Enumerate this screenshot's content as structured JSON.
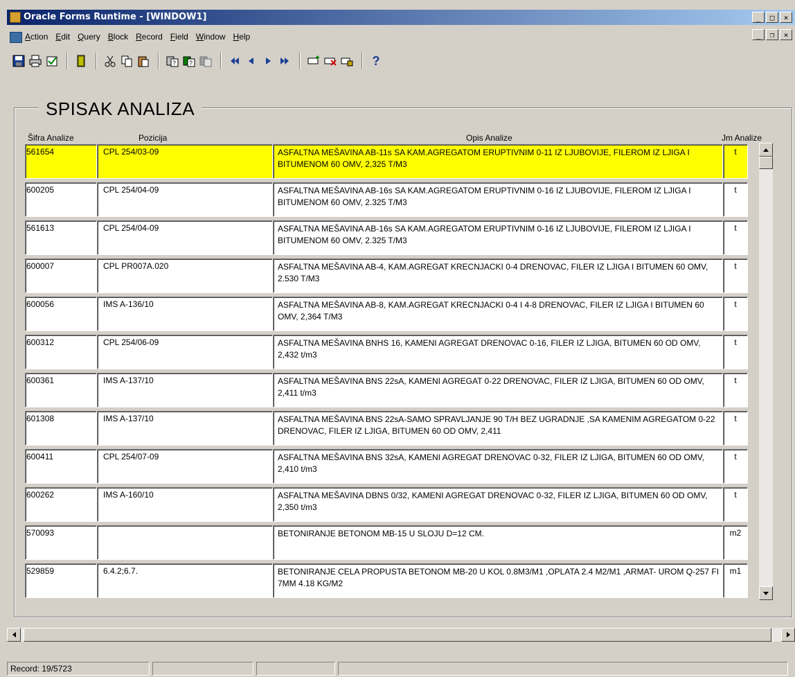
{
  "window": {
    "title": "Oracle Forms Runtime - [WINDOW1]",
    "min_glyph": "_",
    "max_glyph": "□",
    "close_glyph": "×",
    "restore_glyph": "❐"
  },
  "menu": {
    "items": [
      {
        "label": "Action"
      },
      {
        "label": "Edit"
      },
      {
        "label": "Query"
      },
      {
        "label": "Block"
      },
      {
        "label": "Record"
      },
      {
        "label": "Field"
      },
      {
        "label": "Window"
      },
      {
        "label": "Help"
      }
    ]
  },
  "toolbar": {
    "help_glyph": "?"
  },
  "form": {
    "title": "SPISAK ANALIZA",
    "columns": {
      "sifra": "Šifra Analize",
      "pozicija": "Pozicija",
      "opis": "Opis Analize",
      "jm": "Jm Analize"
    },
    "rows": [
      {
        "sifra": "561654",
        "pozicija": "CPL 254/03-09",
        "opis": "ASFALTNA MEŠAVINA AB-11s SA KAM.AGREGATOM ERUPTIVNIM 0-11 IZ LJUBOVIJE, FILEROM IZ LJIGA I BITUMENOM 60 OMV, 2,325 T/M3",
        "jm": "t"
      },
      {
        "sifra": "600205",
        "pozicija": "CPL 254/04-09",
        "opis": "ASFALTNA MEŠAVINA AB-16s SA KAM.AGREGATOM ERUPTIVNIM 0-16 IZ LJUBOVIJE, FILEROM IZ LJIGA I BITUMENOM 60 OMV, 2.325 T/M3",
        "jm": "t"
      },
      {
        "sifra": "561613",
        "pozicija": "CPL 254/04-09",
        "opis": "ASFALTNA MEŠAVINA AB-16s SA KAM.AGREGATOM ERUPTIVNIM 0-16 IZ LJUBOVIJE, FILEROM IZ LJIGA I BITUMENOM 60 OMV, 2.325 T/M3",
        "jm": "t"
      },
      {
        "sifra": "600007",
        "pozicija": "CPL PR007A.020",
        "opis": "ASFALTNA MEŠAVINA AB-4, KAM.AGREGAT KRECNJACKI 0-4  DRENOVAC, FILER IZ LJIGA I BITUMEN 60 OMV, 2.530 T/M3",
        "jm": "t"
      },
      {
        "sifra": "600056",
        "pozicija": "IMS A-136/10",
        "opis": "ASFALTNA MEŠAVINA AB-8, KAM.AGREGAT KRECNJACKI 0-4 I 4-8  DRENOVAC, FILER IZ LJIGA I BITUMEN 60 OMV, 2,364 T/M3",
        "jm": "t"
      },
      {
        "sifra": "600312",
        "pozicija": "CPL 254/06-09",
        "opis": "ASFALTNA MEŠAVINA BNHS 16, KAMENI AGREGAT DRENOVAC 0-16, FILER IZ LJIGA, BITUMEN 60 OD OMV, 2,432  t/m3",
        "jm": "t"
      },
      {
        "sifra": "600361",
        "pozicija": "IMS A-137/10",
        "opis": "ASFALTNA MEŠAVINA BNS 22sA, KAMENI AGREGAT 0-22 DRENOVAC, FILER IZ LJIGA, BITUMEN 60 OD OMV, 2,411 t/m3",
        "jm": "t"
      },
      {
        "sifra": "601308",
        "pozicija": "IMS A-137/10",
        "opis": "ASFALTNA MEŠAVINA BNS 22sA-SAMO SPRAVLJANJE 90 T/H BEZ UGRADNJE ,SA KAMENIM AGREGATOM  0-22 DRENOVAC, FILER IZ LJIGA, BITUMEN 60 OD OMV, 2,411",
        "jm": "t"
      },
      {
        "sifra": "600411",
        "pozicija": "CPL 254/07-09",
        "opis": "ASFALTNA MEŠAVINA BNS 32sA, KAMENI AGREGAT DRENOVAC 0-32, FILER IZ LJIGA, BITUMEN 60 OD OMV, 2,410 t/m3",
        "jm": "t"
      },
      {
        "sifra": "600262",
        "pozicija": "IMS A-160/10",
        "opis": "ASFALTNA MEŠAVINA DBNS 0/32, KAMENI AGREGAT DRENOVAC 0-32, FILER IZ LJIGA, BITUMEN 60 OD OMV, 2,350 t/m3",
        "jm": "t"
      },
      {
        "sifra": "570093",
        "pozicija": "",
        "opis": "BETONIRANJE  BETONOM MB-15 U SLOJU D=12 CM.",
        "jm": "m2"
      },
      {
        "sifra": "529859",
        "pozicija": "6.4.2;6.7.",
        "opis": "BETONIRANJE CELA PROPUSTA BETONOM MB-20 U KOL 0.8M3/M1 ,OPLATA 2.4 M2/M1 ,ARMAT- UROM Q-257 FI 7MM 4.18 KG/M2",
        "jm": "m1"
      }
    ]
  },
  "status": {
    "record": "Record: 19/5723"
  },
  "colors": {
    "selected_row": "#ffff00",
    "titlebar_start": "#0a246a",
    "titlebar_end": "#a6caf0"
  }
}
